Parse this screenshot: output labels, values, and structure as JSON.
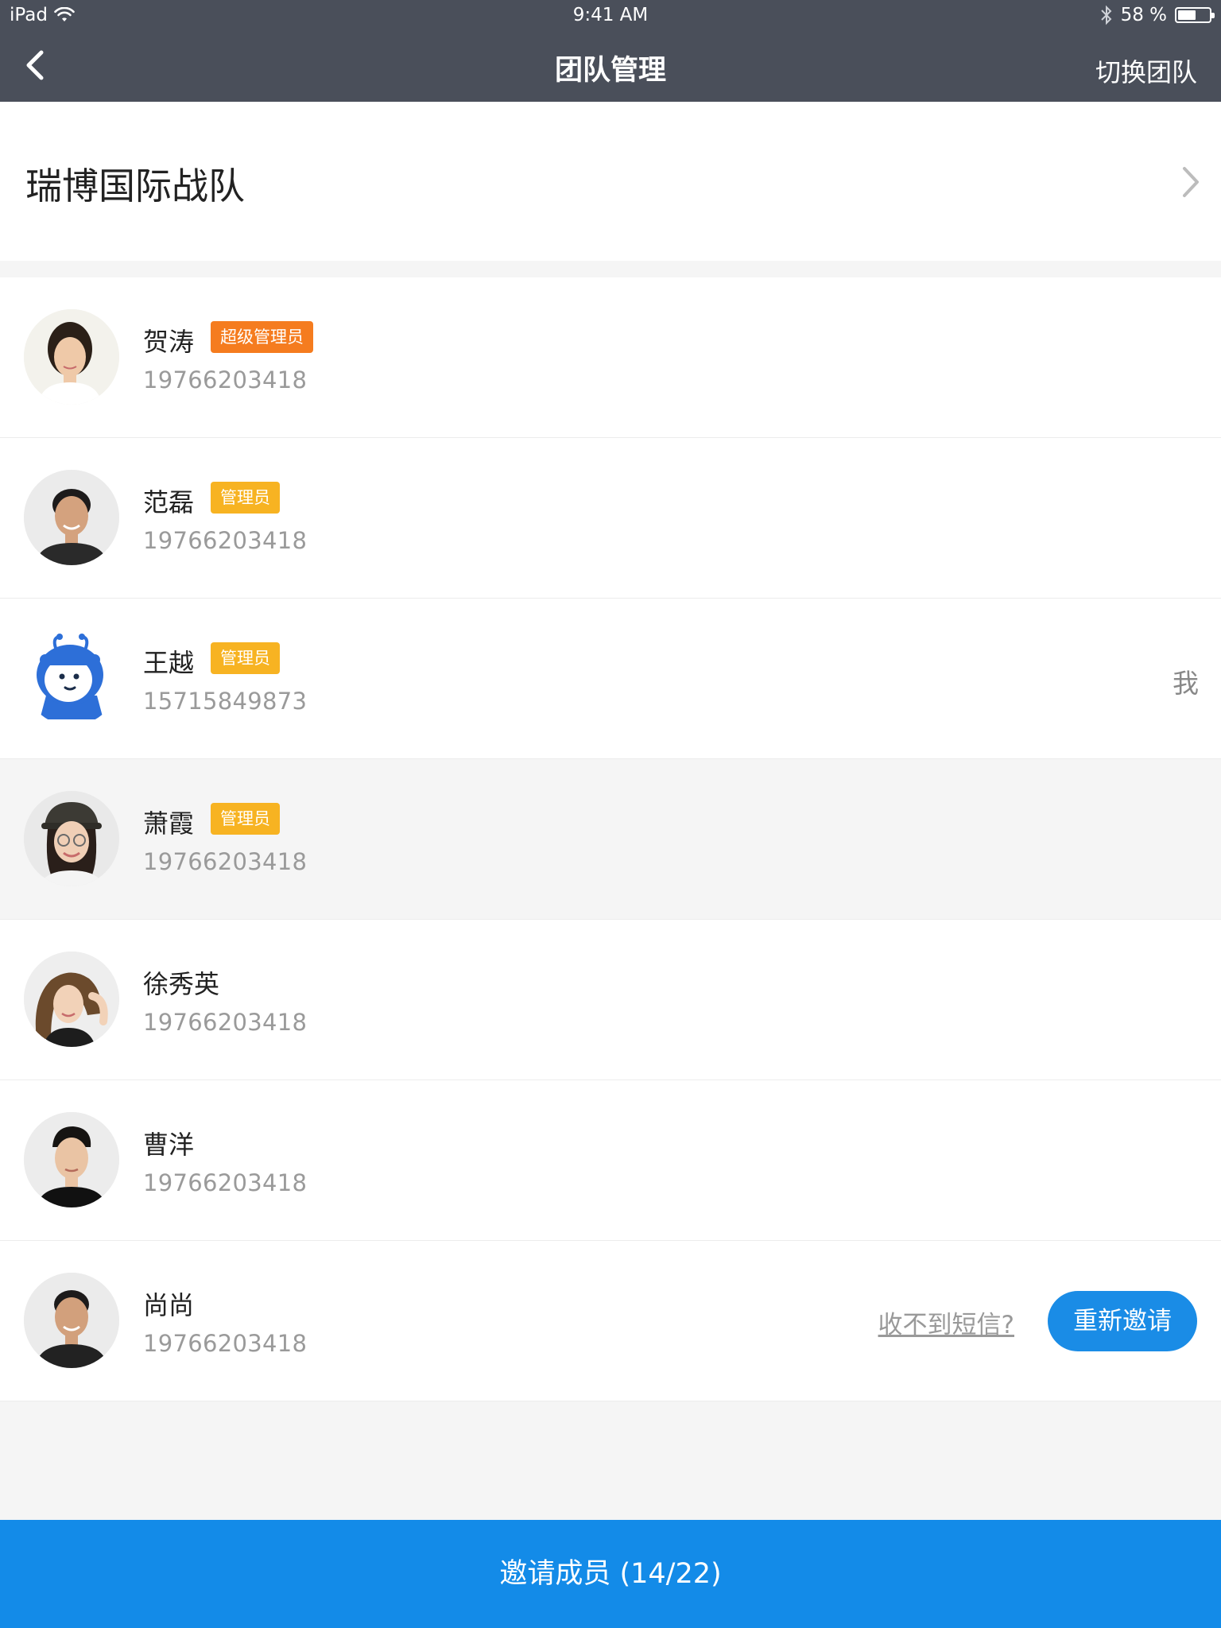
{
  "status": {
    "carrier": "iPad",
    "time": "9:41 AM",
    "battery": "58 %",
    "battery_level": 0.58
  },
  "nav": {
    "title": "团队管理",
    "switch_label": "切换团队"
  },
  "team": {
    "name": "瑞博国际战队"
  },
  "members": [
    {
      "name": "贺涛",
      "phone": "19766203418",
      "role": "超级管理员"
    },
    {
      "name": "范磊",
      "phone": "19766203418",
      "role": "管理员"
    },
    {
      "name": "王越",
      "phone": "15715849873",
      "role": "管理员",
      "me_label": "我"
    },
    {
      "name": "萧霞",
      "phone": "19766203418",
      "role": "管理员"
    },
    {
      "name": "徐秀英",
      "phone": "19766203418"
    },
    {
      "name": "曹洋",
      "phone": "19766203418"
    },
    {
      "name": "尚尚",
      "phone": "19766203418",
      "resend_tip": "收不到短信?",
      "resend_label": "重新邀请"
    }
  ],
  "invite": {
    "label": "邀请成员 (14/22)"
  },
  "colors": {
    "nav_bg": "#4a4f5a",
    "primary": "#138be8",
    "super_admin_badge": "#f57c1f",
    "admin_badge": "#f7b322"
  }
}
